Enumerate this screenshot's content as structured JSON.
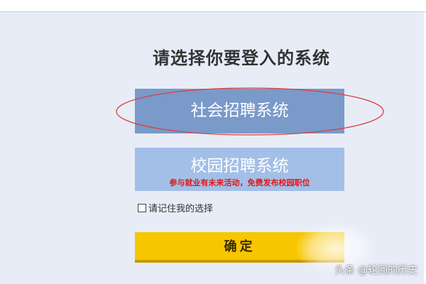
{
  "page": {
    "title": "请选择你要登入的系统"
  },
  "systems": {
    "social_label": "社会招聘系统",
    "campus_label": "校园招聘系统",
    "campus_note": "参与就业有未来活动，免费发布校园职位"
  },
  "remember": {
    "label": "请记住我的选择",
    "checked": false
  },
  "confirm": {
    "label": "确定"
  },
  "watermark": "头条 @轮回的历史",
  "colors": {
    "background": "#e7ecf6",
    "social_button": "#7a9ac9",
    "campus_button": "#a3bfe7",
    "note_text": "#e01818",
    "confirm_button": "#f7c600",
    "annotation": "#d84040"
  }
}
